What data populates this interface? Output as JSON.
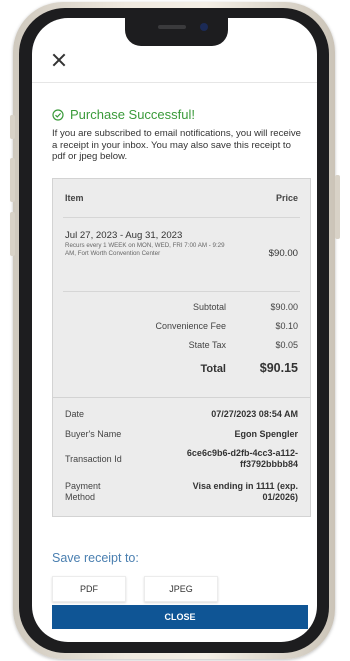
{
  "modal": {
    "title": "Purchase Successful!",
    "message": "If you are subscribed to email notifications, you will receive a receipt in your inbox. You may also save this receipt to pdf or jpeg below."
  },
  "items_table": {
    "header_item": "Item",
    "header_price": "Price",
    "line": {
      "title": "Jul 27, 2023 - Aug 31, 2023",
      "details": "Recurs every 1 WEEK on MON, WED, FRI 7:00 AM - 9:29 AM, Fort Worth Convention Center",
      "price": "$90.00"
    },
    "subtotal_label": "Subtotal",
    "subtotal_value": "$90.00",
    "fee_label": "Convenience Fee",
    "fee_value": "$0.10",
    "tax_label": "State Tax",
    "tax_value": "$0.05",
    "total_label": "Total",
    "total_value": "$90.15"
  },
  "details": {
    "date_label": "Date",
    "date_value": "07/27/2023 08:54 AM",
    "buyer_label": "Buyer's Name",
    "buyer_value": "Egon Spengler",
    "transaction_label": "Transaction Id",
    "transaction_value": "6ce6c9b6-d2fb-4cc3-a112-ff3792bbbb84",
    "payment_label": "Payment Method",
    "payment_value": "Visa ending in 1111 (exp. 01/2026)"
  },
  "save": {
    "title": "Save receipt to:",
    "pdf_label": "PDF",
    "jpeg_label": "JPEG"
  },
  "close_label": "CLOSE",
  "colors": {
    "success": "#3a9a3a",
    "link_blue": "#4a7fb0",
    "primary_button": "#0f5595"
  }
}
